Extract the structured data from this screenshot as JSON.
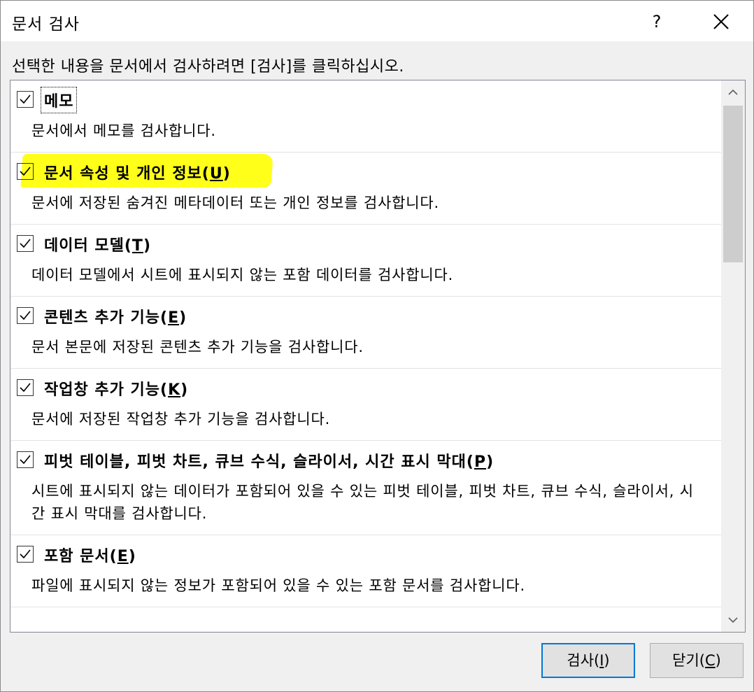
{
  "dialog": {
    "title": "문서 검사",
    "help_glyph": "?",
    "instruction": "선택한 내용을 문서에서 검사하려면 [검사]를 클릭하십시오."
  },
  "items": [
    {
      "title": "메모",
      "accel": "",
      "accel_suffix": "",
      "checked": true,
      "description": "문서에서 메모를 검사합니다."
    },
    {
      "title": "문서 속성 및 개인 정보(",
      "accel": "U",
      "accel_suffix": ")",
      "checked": true,
      "description": "문서에 저장된 숨겨진 메타데이터 또는 개인 정보를 검사합니다."
    },
    {
      "title": "데이터 모델(",
      "accel": "T",
      "accel_suffix": ")",
      "checked": true,
      "description": "데이터 모델에서 시트에 표시되지 않는 포함 데이터를 검사합니다."
    },
    {
      "title": "콘텐츠 추가 기능(",
      "accel": "E",
      "accel_suffix": ")",
      "checked": true,
      "description": "문서 본문에 저장된 콘텐츠 추가 기능을 검사합니다."
    },
    {
      "title": "작업창 추가 기능(",
      "accel": "K",
      "accel_suffix": ")",
      "checked": true,
      "description": "문서에 저장된 작업창 추가 기능을 검사합니다."
    },
    {
      "title": "피벗 테이블, 피벗 차트, 큐브 수식, 슬라이서, 시간 표시 막대(",
      "accel": "P",
      "accel_suffix": ")",
      "checked": true,
      "description": "시트에 표시되지 않는 데이터가 포함되어 있을 수 있는 피벗 테이블, 피벗 차트, 큐브 수식, 슬라이서, 시간 표시 막대를 검사합니다."
    },
    {
      "title": "포함 문서(",
      "accel": "E",
      "accel_suffix": ")",
      "checked": true,
      "description": "파일에 표시되지 않는 정보가 포함되어 있을 수 있는 포함 문서를 검사합니다."
    }
  ],
  "buttons": {
    "inspect": {
      "label": "검사(",
      "accel": "I",
      "suffix": ")"
    },
    "close": {
      "label": "닫기(",
      "accel": "C",
      "suffix": ")"
    }
  },
  "icons": {
    "help": "question-mark",
    "close": "x-mark",
    "scroll_up": "chevron-up",
    "scroll_down": "chevron-down",
    "checkbox": "checkmark"
  },
  "colors": {
    "highlight": "#ffff1a",
    "primary_button_border": "#0078d7"
  },
  "scroll_position": 0
}
